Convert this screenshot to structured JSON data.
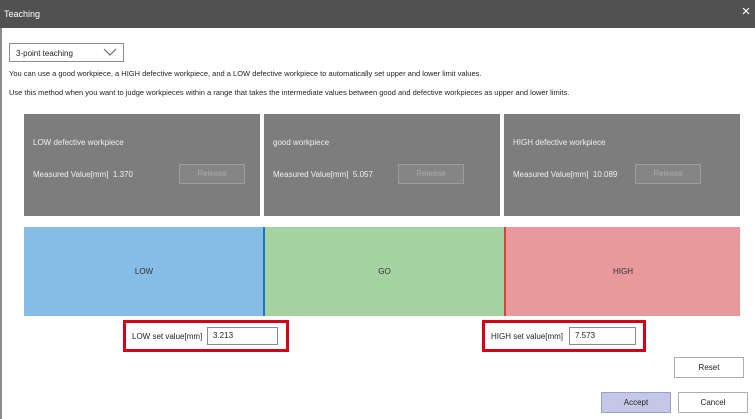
{
  "window": {
    "title": "Teaching",
    "close_glyph": "×"
  },
  "mode_select": {
    "value": "3-point teaching",
    "icon": "chevron-down-icon"
  },
  "info": {
    "line1": "You can use a good workpiece, a HIGH defective workpiece, and a LOW defective workpiece to automatically set upper and lower limit values.",
    "line2": "Use this method when you want to judge workpieces within a range that takes the intermediate values between good and defective workpieces as upper and lower limits."
  },
  "panels": [
    {
      "name": "LOW defective workpiece",
      "measured_label": "Measured Value[mm]",
      "measured_value": "1.370",
      "release_label": "Release"
    },
    {
      "name": "good workpiece",
      "measured_label": "Measured Value[mm]",
      "measured_value": "5.057",
      "release_label": "Release"
    },
    {
      "name": "HIGH defective workpiece",
      "measured_label": "Measured Value[mm]",
      "measured_value": "10.089",
      "release_label": "Release"
    }
  ],
  "zones": {
    "low": "LOW",
    "go": "GO",
    "high": "HIGH"
  },
  "set_values": {
    "low_label": "LOW set value[mm]",
    "low_value": "3.213",
    "high_label": "HIGH set value[mm]",
    "high_value": "7.573"
  },
  "buttons": {
    "reset": "Reset",
    "accept": "Accept",
    "cancel": "Cancel"
  },
  "colors": {
    "low_zone": "#85bde6",
    "go_zone": "#a4d2a1",
    "high_zone": "#e8999b",
    "highlight_box": "#d4001a",
    "panel_bg": "#7d7d7d"
  }
}
